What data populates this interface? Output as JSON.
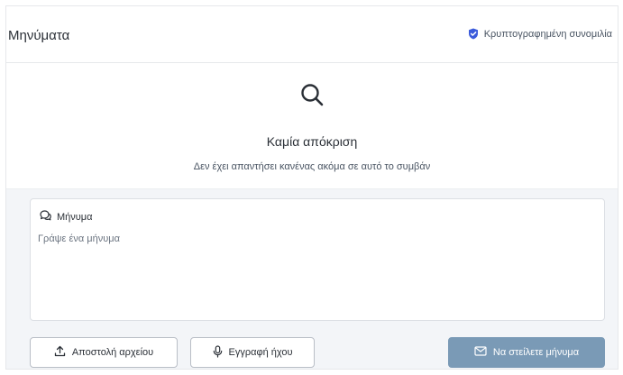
{
  "header": {
    "title": "Μηνύματα",
    "encryption_label": "Κρυπτογραφημένη συνομιλία"
  },
  "empty_state": {
    "title": "Καμία απόκριση",
    "subtitle": "Δεν έχει απαντήσει κανένας ακόμα σε αυτό το συμβάν"
  },
  "composer": {
    "label": "Μήνυμα",
    "placeholder": "Γράψε ένα μήνυμα",
    "value": "",
    "upload_label": "Αποστολή αρχείου",
    "record_label": "Εγγραφή ήχου",
    "send_label": "Να στείλετε μήνυμα"
  },
  "icons": {
    "shield": "shield-check-icon",
    "search": "search-icon",
    "chat": "chat-bubbles-icon",
    "upload": "upload-icon",
    "mic": "microphone-icon",
    "send": "envelope-icon"
  },
  "colors": {
    "accent": "#3b5bdb",
    "send_button": "#7a9ab6",
    "composer_bg": "#f3f5f8"
  }
}
